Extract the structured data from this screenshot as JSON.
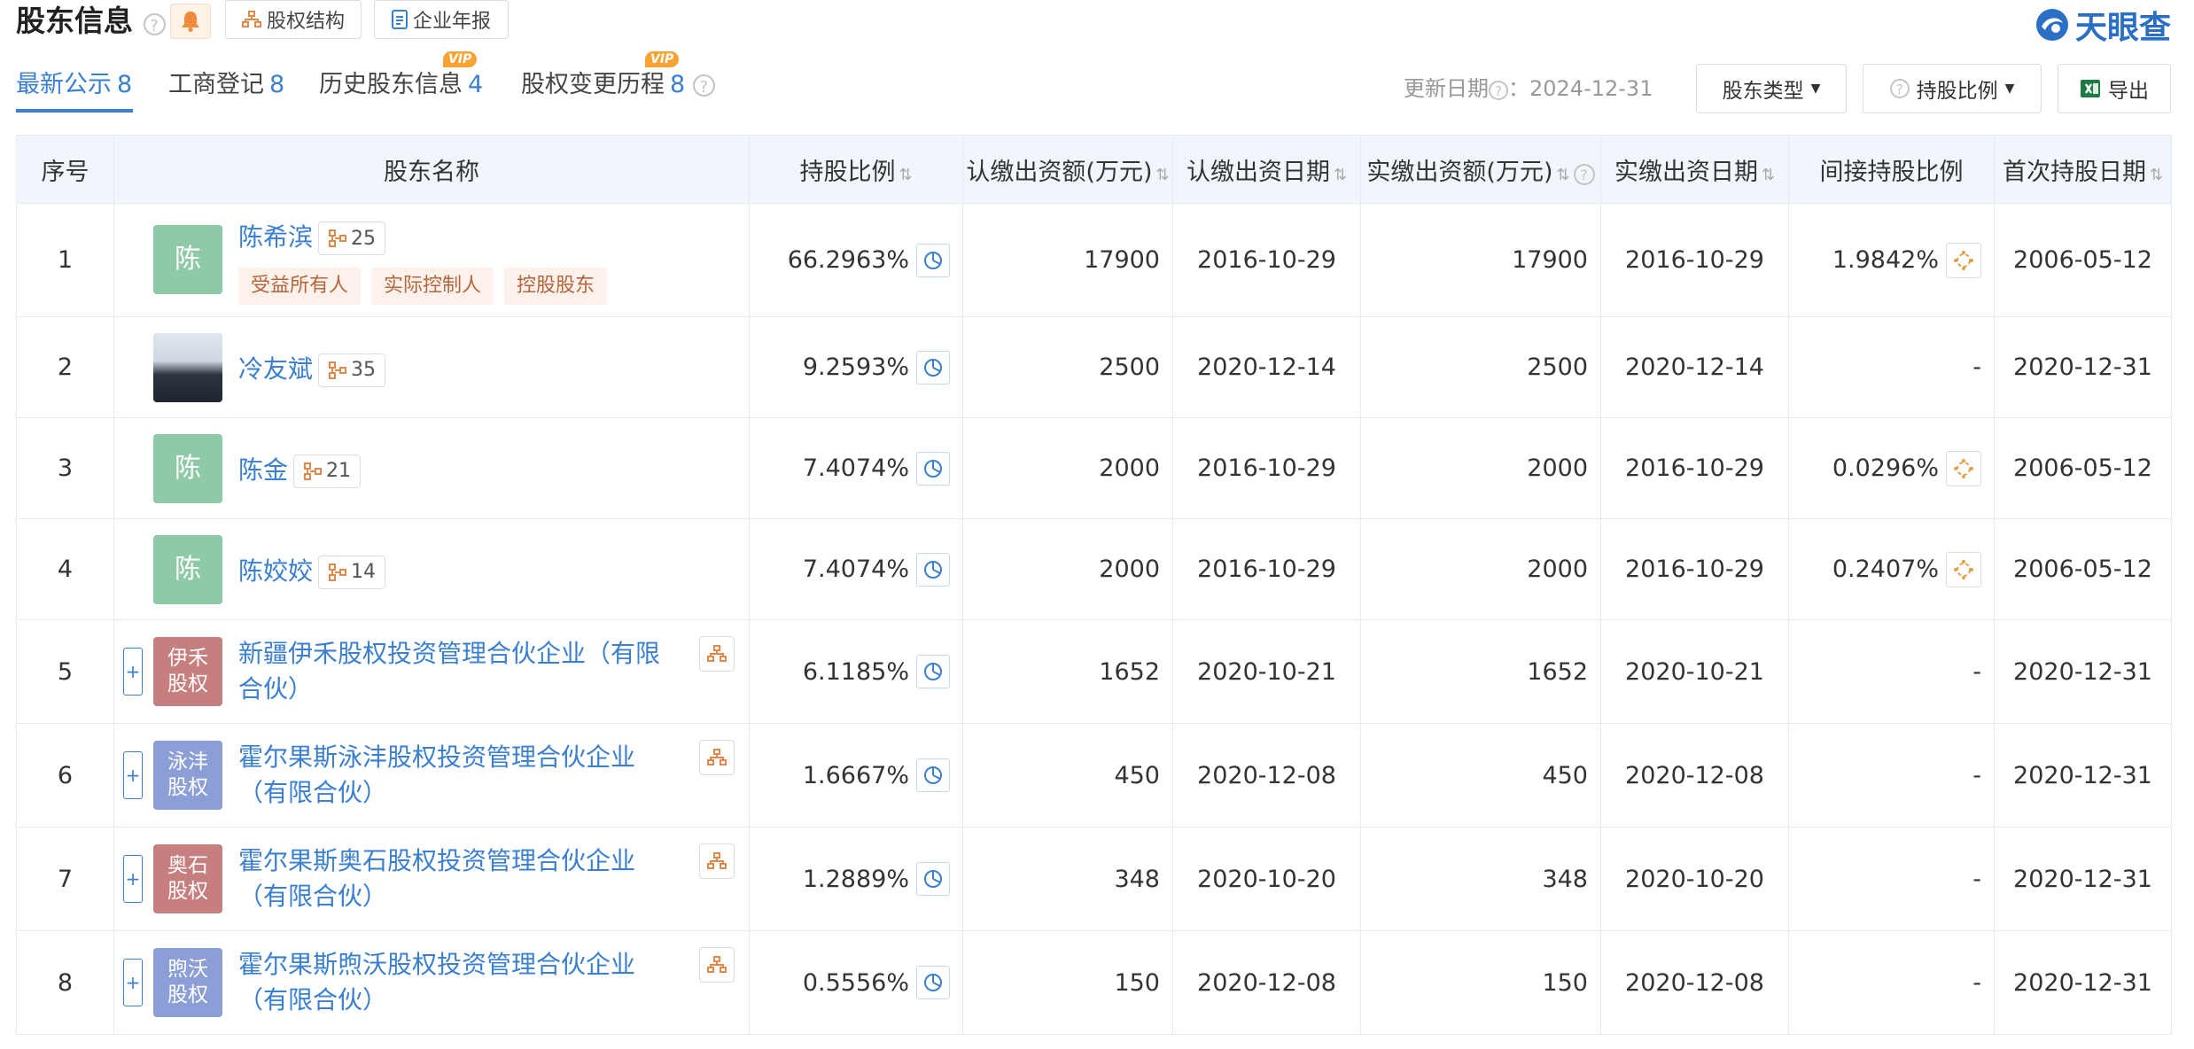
{
  "header": {
    "title": "股东信息",
    "buttons": {
      "equity_structure": "股权结构",
      "annual_report": "企业年报"
    },
    "logo_text": "天眼查"
  },
  "tabs": [
    {
      "label": "最新公示",
      "count": "8",
      "vip": ""
    },
    {
      "label": "工商登记",
      "count": "8",
      "vip": ""
    },
    {
      "label": "历史股东信息",
      "count": "4",
      "vip": "VIP"
    },
    {
      "label": "股权变更历程",
      "count": "8",
      "vip": "VIP"
    }
  ],
  "toolbar": {
    "update_label": "更新日期",
    "update_date": "：2024-12-31",
    "shareholder_type": "股东类型",
    "holding_ratio": "持股比例",
    "export": "导出"
  },
  "columns": [
    "序号",
    "股东名称",
    "持股比例",
    "认缴出资额(万元)",
    "认缴出资日期",
    "实缴出资额(万元)",
    "实缴出资日期",
    "间接持股比例",
    "首次持股日期"
  ],
  "rows": [
    {
      "idx": "1",
      "avatar": "陈",
      "name": "陈希滨",
      "chain": "25",
      "tags": [
        "受益所有人",
        "实际控制人",
        "控股股东"
      ],
      "ratio": "66.2963%",
      "sub_amt": "17900",
      "sub_date": "2016-10-29",
      "paid_amt": "17900",
      "paid_date": "2016-10-29",
      "indirect": "1.9842%",
      "first_date": "2006-05-12"
    },
    {
      "idx": "2",
      "avatar": "",
      "name": "冷友斌",
      "chain": "35",
      "tags": [],
      "ratio": "9.2593%",
      "sub_amt": "2500",
      "sub_date": "2020-12-14",
      "paid_amt": "2500",
      "paid_date": "2020-12-14",
      "indirect": "-",
      "first_date": "2020-12-31"
    },
    {
      "idx": "3",
      "avatar": "陈",
      "name": "陈金",
      "chain": "21",
      "tags": [],
      "ratio": "7.4074%",
      "sub_amt": "2000",
      "sub_date": "2016-10-29",
      "paid_amt": "2000",
      "paid_date": "2016-10-29",
      "indirect": "0.0296%",
      "first_date": "2006-05-12"
    },
    {
      "idx": "4",
      "avatar": "陈",
      "name": "陈姣姣",
      "chain": "14",
      "tags": [],
      "ratio": "7.4074%",
      "sub_amt": "2000",
      "sub_date": "2016-10-29",
      "paid_amt": "2000",
      "paid_date": "2016-10-29",
      "indirect": "0.2407%",
      "first_date": "2006-05-12"
    },
    {
      "idx": "5",
      "avatar": "伊禾股权",
      "name": "新疆伊禾股权投资管理合伙企业（有限合伙）",
      "chain": "",
      "tags": [],
      "ratio": "6.1185%",
      "sub_amt": "1652",
      "sub_date": "2020-10-21",
      "paid_amt": "1652",
      "paid_date": "2020-10-21",
      "indirect": "-",
      "first_date": "2020-12-31"
    },
    {
      "idx": "6",
      "avatar": "泳沣股权",
      "name": "霍尔果斯泳沣股权投资管理合伙企业（有限合伙）",
      "chain": "",
      "tags": [],
      "ratio": "1.6667%",
      "sub_amt": "450",
      "sub_date": "2020-12-08",
      "paid_amt": "450",
      "paid_date": "2020-12-08",
      "indirect": "-",
      "first_date": "2020-12-31"
    },
    {
      "idx": "7",
      "avatar": "奥石股权",
      "name": "霍尔果斯奥石股权投资管理合伙企业（有限合伙）",
      "chain": "",
      "tags": [],
      "ratio": "1.2889%",
      "sub_amt": "348",
      "sub_date": "2020-10-20",
      "paid_amt": "348",
      "paid_date": "2020-10-20",
      "indirect": "-",
      "first_date": "2020-12-31"
    },
    {
      "idx": "8",
      "avatar": "煦沃股权",
      "name": "霍尔果斯煦沃股权投资管理合伙企业（有限合伙）",
      "chain": "",
      "tags": [],
      "ratio": "0.5556%",
      "sub_amt": "150",
      "sub_date": "2020-12-08",
      "paid_amt": "150",
      "paid_date": "2020-12-08",
      "indirect": "-",
      "first_date": "2020-12-31"
    }
  ],
  "colors": {
    "accent": "#3a7fd0",
    "vip": "#f7a233",
    "tag_bg": "#fdf1ec",
    "tag_text": "#b4663c",
    "header_bg": "#f1f6fc"
  }
}
